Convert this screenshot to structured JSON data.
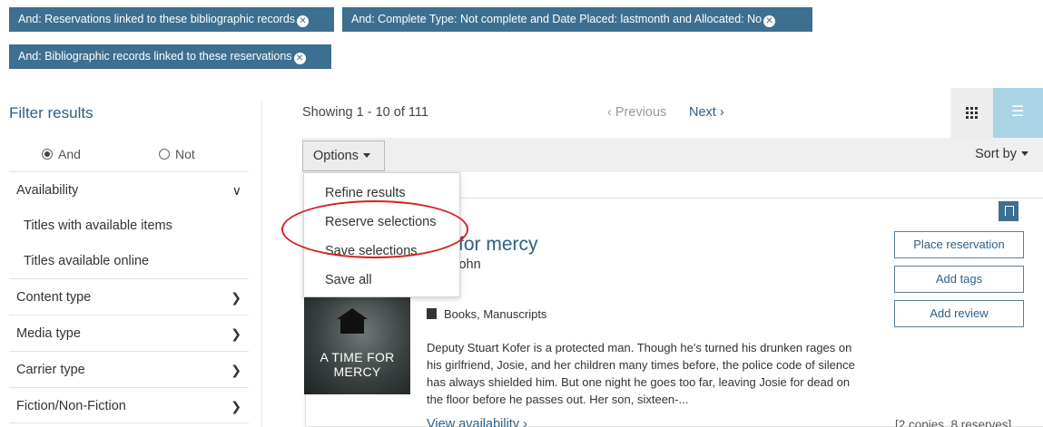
{
  "chips": [
    {
      "label": "And: Reservations linked to these bibliographic records"
    },
    {
      "label": "And: Complete Type: Not complete and Date Placed: lastmonth and Allocated: No"
    },
    {
      "label": "And: Bibliographic records linked to these reservations"
    }
  ],
  "sidebar": {
    "title": "Filter results",
    "and_label": "And",
    "not_label": "Not",
    "availability": {
      "label": "Availability",
      "options": [
        "Titles with available items",
        "Titles available online"
      ]
    },
    "facets": [
      "Content type",
      "Media type",
      "Carrier type",
      "Fiction/Non-Fiction"
    ]
  },
  "results": {
    "showing": "Showing 1 - 10 of 111",
    "previous": "Previous",
    "next": "Next",
    "options_label": "Options",
    "sort_label": "Sort by"
  },
  "menu": {
    "items": [
      "Refine results",
      "Reserve selections",
      "Save selections",
      "Save all"
    ]
  },
  "record": {
    "title": "A time for mercy",
    "title_visible": "me for mercy",
    "author": "Grisham, John",
    "author_visible": "am, John",
    "media": "Books, Manuscripts",
    "summary": "Deputy Stuart Kofer is a protected man. Though he's turned his drunken rages on his girlfriend, Josie, and her children many times before, the police code of silence has always shielded him. But one night he goes too far, leaving Josie for dead on the floor before he passes out. Her son, sixteen-...",
    "view_availability": "View availability",
    "copies": "[2 copies, 8 reserves]",
    "cover_text": "A TIME FOR MERCY",
    "actions": [
      "Place reservation",
      "Add tags",
      "Add review"
    ]
  },
  "colors": {
    "accent": "#3d6f91",
    "link": "#2e5f85",
    "annotation": "#d62020",
    "list_view_active": "#a9d4e5"
  }
}
